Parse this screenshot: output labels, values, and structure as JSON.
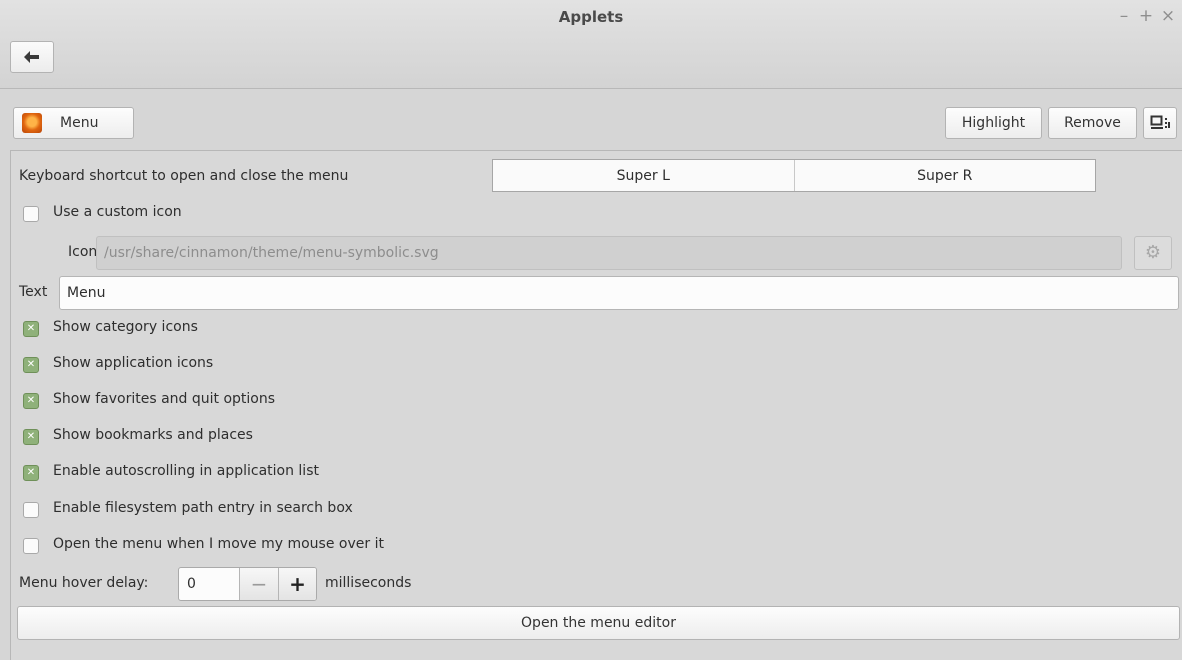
{
  "window": {
    "title": "Applets",
    "controls": {
      "minimize": "–",
      "maximize": "+",
      "close": "×"
    }
  },
  "header": {
    "applet_name": "Menu",
    "highlight_label": "Highlight",
    "remove_label": "Remove"
  },
  "settings": {
    "shortcut_label": "Keyboard shortcut to open and close the menu",
    "shortcut_primary": "Super L",
    "shortcut_secondary": "Super R",
    "custom_icon_label": "Use a custom icon",
    "custom_icon_checked": false,
    "icon_label": "Icon",
    "icon_path": "/usr/share/cinnamon/theme/menu-symbolic.svg",
    "text_label": "Text",
    "text_value": "Menu",
    "options": [
      {
        "label": "Show category icons",
        "checked": true
      },
      {
        "label": "Show application icons",
        "checked": true
      },
      {
        "label": "Show favorites and quit options",
        "checked": true
      },
      {
        "label": "Show bookmarks and places",
        "checked": true
      },
      {
        "label": "Enable autoscrolling in application list",
        "checked": true
      },
      {
        "label": "Enable filesystem path entry in search box",
        "checked": false
      },
      {
        "label": "Open the menu when I move my mouse over it",
        "checked": false
      }
    ],
    "hover_delay_label": "Menu hover delay:",
    "hover_delay_value": "0",
    "hover_delay_unit": "milliseconds",
    "editor_button": "Open the menu editor"
  }
}
